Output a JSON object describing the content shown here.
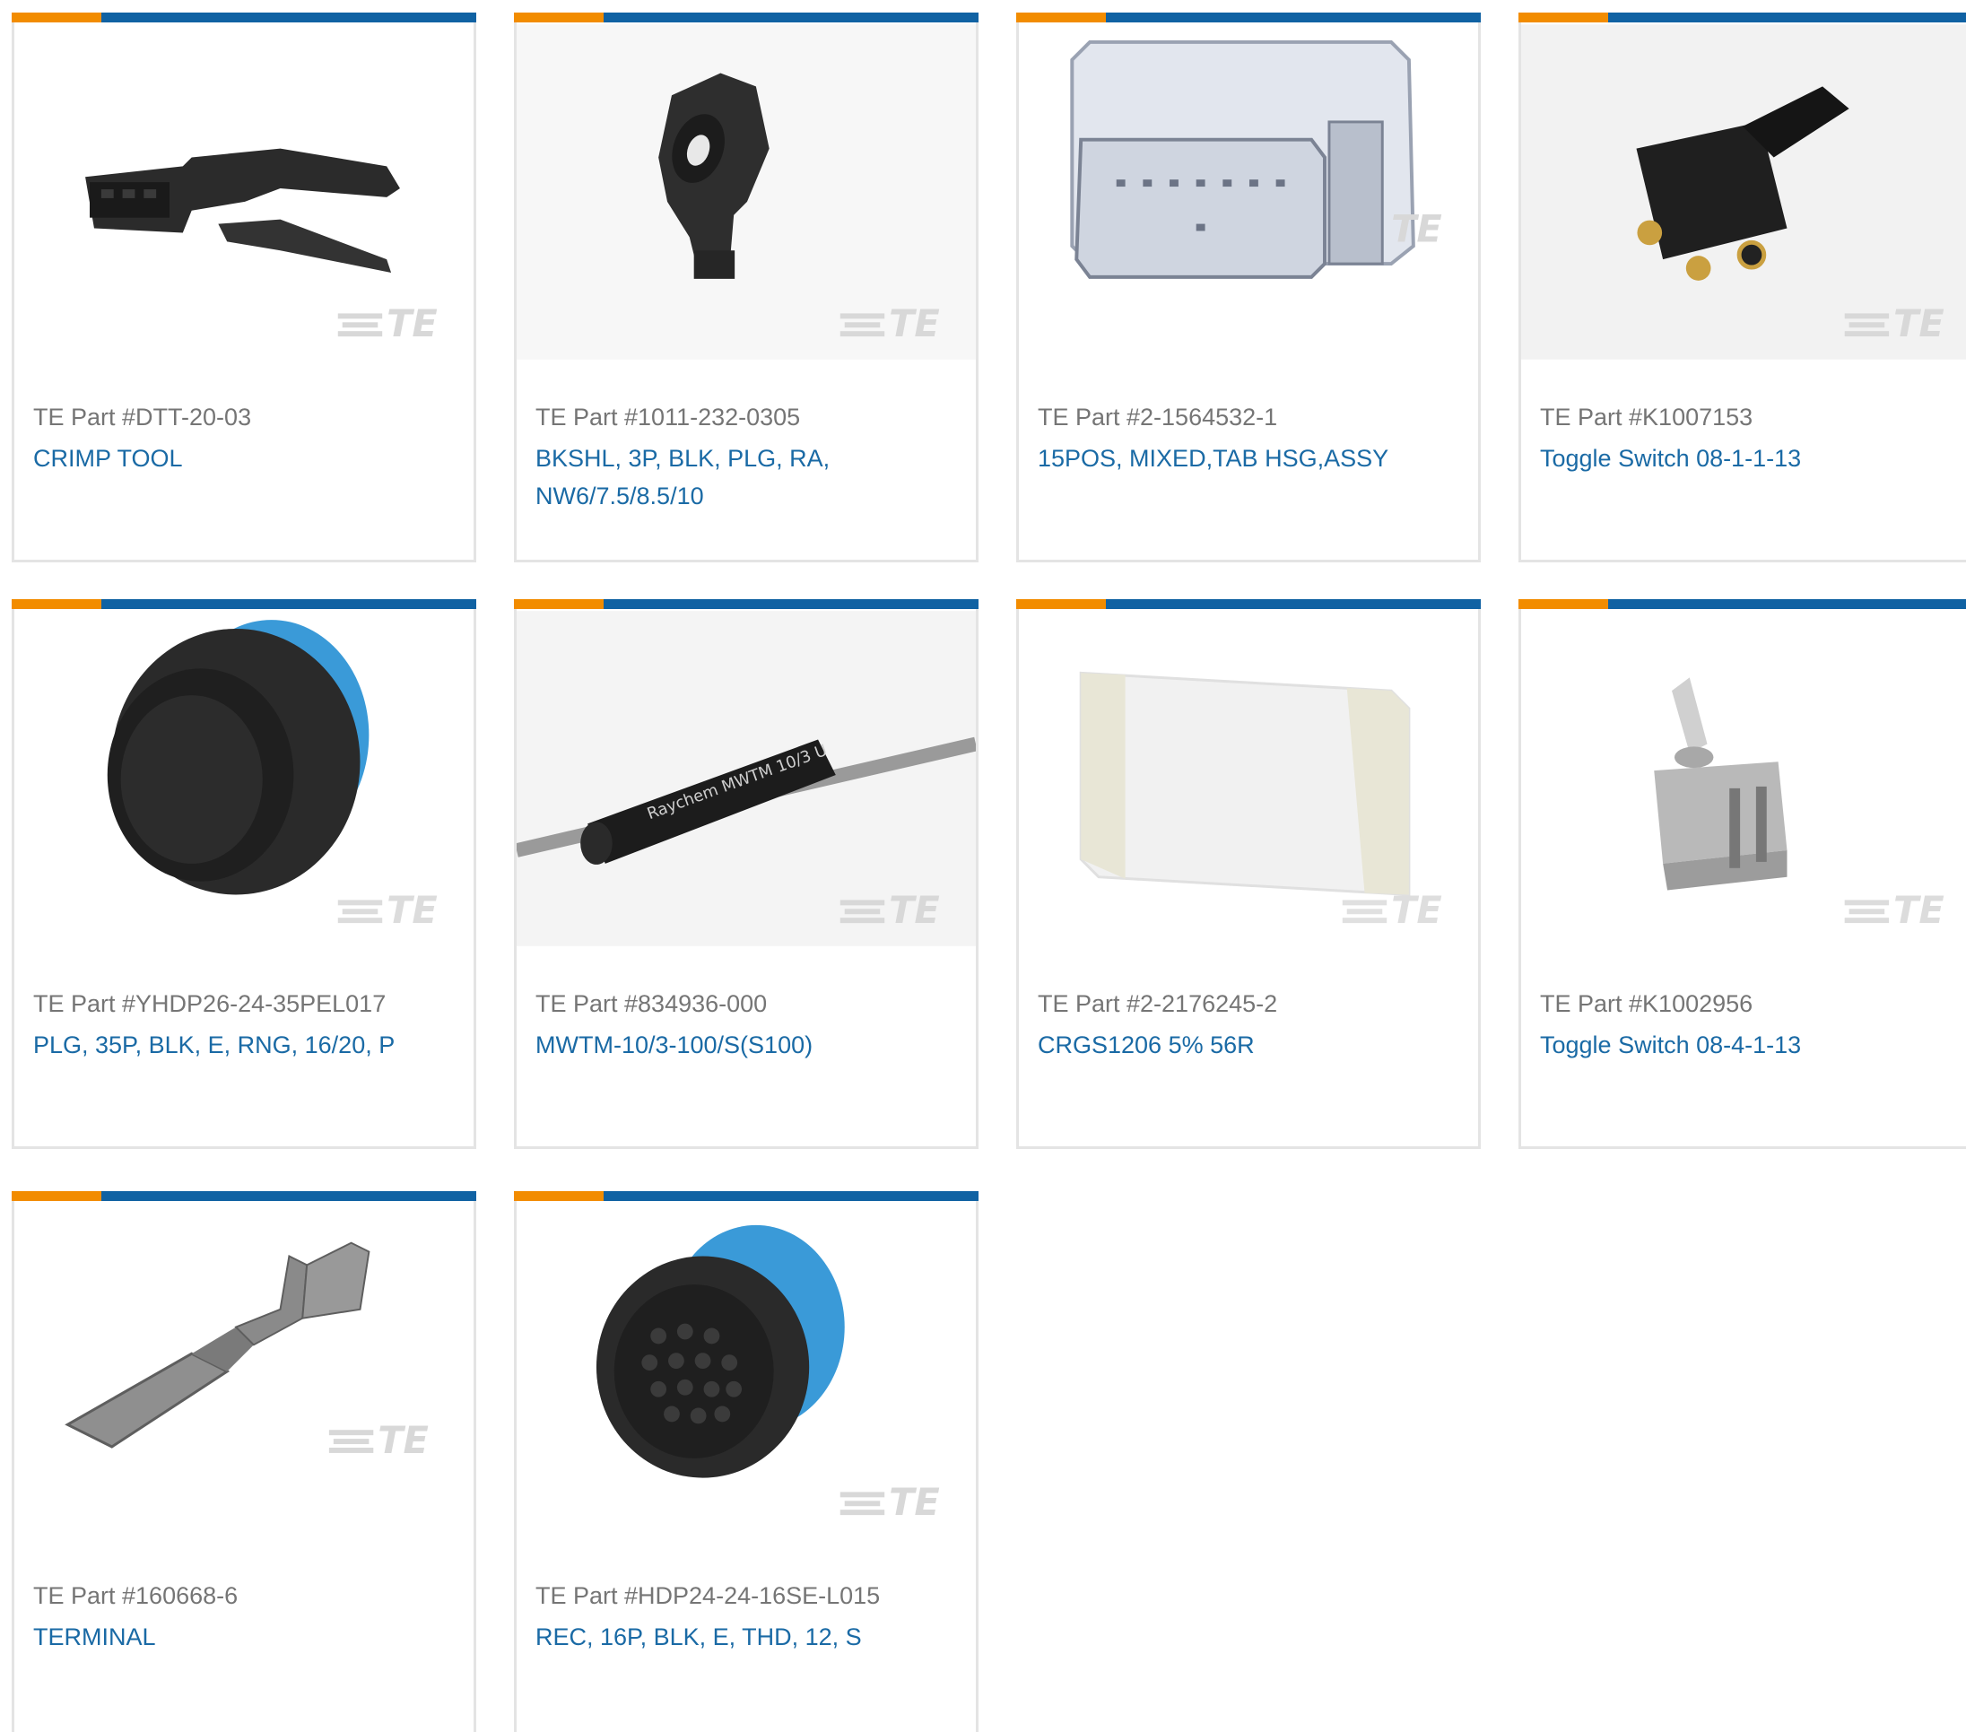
{
  "products": [
    {
      "part_label": "TE Part #DTT-20-03",
      "description": "CRIMP TOOL",
      "image_icon": "crimp-tool-icon",
      "watermark": "TE"
    },
    {
      "part_label": "TE Part #1011-232-0305",
      "description": "BKSHL, 3P, BLK, PLG, RA, NW6/7.5/8.5/10",
      "image_icon": "backshell-icon",
      "watermark": "TE"
    },
    {
      "part_label": "TE Part #2-1564532-1",
      "description": "15POS, MIXED,TAB HSG,ASSY",
      "image_icon": "tab-housing-icon",
      "watermark": "TE"
    },
    {
      "part_label": "TE Part #K1007153",
      "description": "Toggle Switch 08-1-1-13",
      "image_icon": "toggle-switch-black-icon",
      "watermark": "TE"
    },
    {
      "part_label": "TE Part #YHDP26-24-35PEL017",
      "description": "PLG, 35P, BLK, E, RNG, 16/20, P",
      "image_icon": "circular-plug-icon",
      "watermark": "TE"
    },
    {
      "part_label": "TE Part #834936-000",
      "description": "MWTM-10/3-100/S(S100)",
      "image_icon": "heat-shrink-tube-icon",
      "watermark": "TE",
      "print": "Raychem MWTM 10/3 U"
    },
    {
      "part_label": "TE Part #2-2176245-2",
      "description": "CRGS1206 5% 56R",
      "image_icon": "chip-resistor-icon",
      "watermark": "TE"
    },
    {
      "part_label": "TE Part #K1002956",
      "description": "Toggle Switch 08-4-1-13",
      "image_icon": "toggle-switch-grey-icon",
      "watermark": "TE"
    },
    {
      "part_label": "TE Part #160668-6",
      "description": "TERMINAL",
      "image_icon": "terminal-icon",
      "watermark": "TE"
    },
    {
      "part_label": "TE Part #HDP24-24-16SE-L015",
      "description": "REC, 16P, BLK, E, THD, 12, S",
      "image_icon": "circular-receptacle-icon",
      "watermark": "TE"
    }
  ],
  "colors": {
    "accent_orange": "#f28c00",
    "accent_blue": "#1062a3",
    "link": "#1a6aa5",
    "meta_text": "#757575",
    "card_border": "#e4e4e4"
  }
}
